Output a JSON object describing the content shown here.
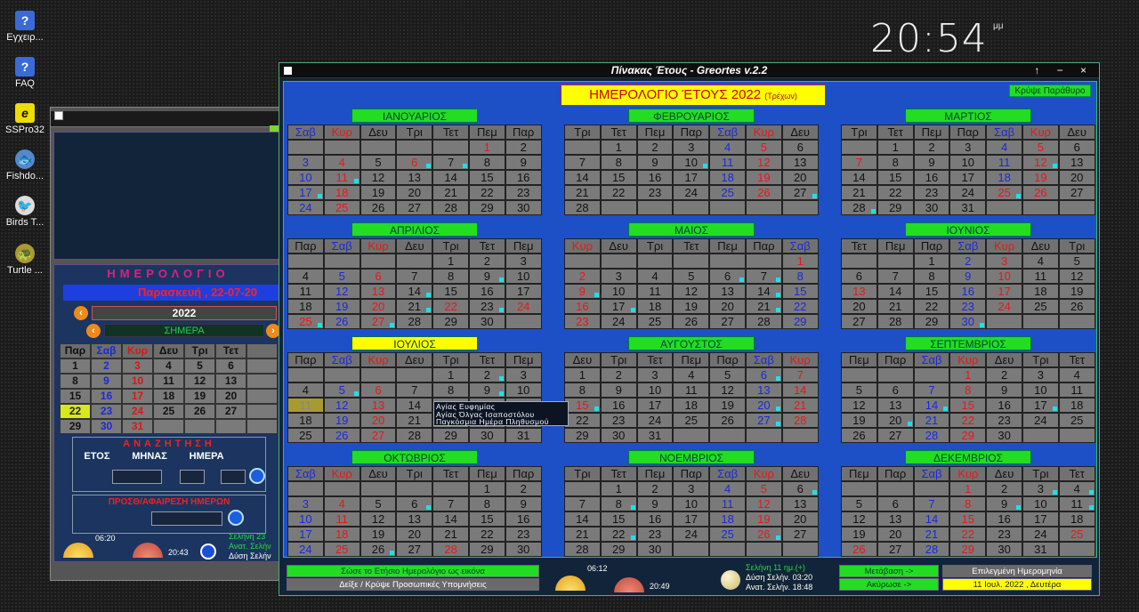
{
  "desktop": {
    "icons": [
      {
        "label": "Εγχειρ...",
        "glyph": "?"
      },
      {
        "label": "FAQ",
        "glyph": "?"
      },
      {
        "label": "SSPro32",
        "glyph": "e"
      },
      {
        "label": "Fishdo...",
        "glyph": "🐟"
      },
      {
        "label": "Birds T...",
        "glyph": "🐦"
      },
      {
        "label": "Turtle ...",
        "glyph": "🐢"
      }
    ],
    "clock": "20:54",
    "ampm": "μμ"
  },
  "small_window": {
    "title": "ΗΜΕΡΟΛΟΓΙΟ",
    "date_line": "Παρασκευή , 22-07-20",
    "year": "2022",
    "today_label": "ΣΗΜΕΡΑ",
    "headers": [
      "Παρ",
      "Σαβ",
      "Κυρ",
      "Δευ",
      "Τρι",
      "Τετ",
      ""
    ],
    "weeks": [
      [
        "1",
        "2",
        "3",
        "4",
        "5",
        "6",
        ""
      ],
      [
        "8",
        "9",
        "10",
        "11",
        "12",
        "13",
        ""
      ],
      [
        "15",
        "16",
        "17",
        "18",
        "19",
        "20",
        ""
      ],
      [
        "22",
        "23",
        "24",
        "25",
        "26",
        "27",
        ""
      ],
      [
        "29",
        "30",
        "31",
        "",
        "",
        "",
        ""
      ]
    ],
    "search_title": "ΑΝΑΖΗΤΗΣΗ",
    "search_headers": [
      "ΕΤΟΣ",
      "ΜΗΝΑΣ",
      "ΗΜΕΡΑ"
    ],
    "subtract_title": "ΠΡΟΣΘ/ΑΦΑΙΡΕΣΗ ΗΜΕΡΩΝ",
    "sunrise": "06:20",
    "sunset": "20:43",
    "moon_line1": "Σελήνη 23",
    "moon_line2": "Ανατ. Σελήν",
    "moon_line3": "Δύση Σελήν"
  },
  "main_window": {
    "title": "Πίνακας Έτους - Greortes v.2.2",
    "controls": "↑ − ×",
    "header_title": "ΗΜΕΡΟΛΟΓΙΟ ΈΤΟΥΣ 2022",
    "header_sub": "(Τρέχων)",
    "hide_button": "Κρύψε Παράθυρο",
    "tooltip": [
      "Αγίας Ευφημίας",
      "Αγίας Όλγας Ισαποστόλου",
      "Παγκόσμια Ημέρα Πληθυσμού"
    ],
    "bottom": {
      "save_button": "Σώσε το Ετήσιο Ημερολόγιο ως εικόνα",
      "notes_button": "Δείξε / Κρύψε Προσωπικές Υπομνήσεις",
      "sunrise": "06:12",
      "sunset": "20:49",
      "moon_phase": "Σελήνη 11 ημ.(+)",
      "moon_set": "Δύση Σελήν. 03:20",
      "moon_rise": "Ανατ. Σελήν. 18:48",
      "goto_button": "Μετάβαση ->",
      "cancel_button": "Ακύρωσε ->",
      "selected_label": "Επιλεγμένη Ημερομηνία",
      "selected_value": "11 Ιουλ. 2022 , Δευτέρα"
    }
  },
  "colors": {
    "green": "#22dd22",
    "yellow": "#ffff00",
    "panel_blue": "#1d4fc7",
    "saturday": "#1a2ad8",
    "sunday": "#e81818",
    "dot": "#1ee0e8"
  },
  "months": [
    {
      "name": "ΙΑΝΟΥΑΡΙΟΣ",
      "first": 5,
      "days": 31,
      "headers": [
        "Σαβ",
        "Κυρ",
        "Δευ",
        "Τρι",
        "Τετ",
        "Πεμ",
        "Παρ"
      ],
      "dots": [
        6,
        7,
        11,
        17
      ],
      "holidays": [
        1,
        6
      ]
    },
    {
      "name": "ΦΕΒΡΟΥΑΡΙΟΣ",
      "first": 1,
      "days": 28,
      "headers": [
        "Τρι",
        "Τετ",
        "Πεμ",
        "Παρ",
        "Σαβ",
        "Κυρ",
        "Δευ"
      ],
      "dots": [
        10,
        27
      ],
      "holidays": []
    },
    {
      "name": "ΜΑΡΤΙΟΣ",
      "first": 1,
      "days": 31,
      "headers": [
        "Τρι",
        "Τετ",
        "Πεμ",
        "Παρ",
        "Σαβ",
        "Κυρ",
        "Δευ"
      ],
      "dots": [
        12,
        25,
        28
      ],
      "holidays": [
        7,
        25
      ]
    },
    {
      "name": "ΑΠΡΙΛΙΟΣ",
      "first": 4,
      "days": 30,
      "headers": [
        "Παρ",
        "Σαβ",
        "Κυρ",
        "Δευ",
        "Τρι",
        "Τετ",
        "Πεμ"
      ],
      "dots": [
        9,
        14,
        21,
        23,
        25,
        27
      ],
      "holidays": [
        22,
        24,
        25
      ]
    },
    {
      "name": "ΜΑΙΟΣ",
      "first": 6,
      "days": 31,
      "headers": [
        "Κυρ",
        "Δευ",
        "Τρι",
        "Τετ",
        "Πεμ",
        "Παρ",
        "Σαβ"
      ],
      "dots": [
        6,
        7,
        9,
        14,
        17,
        21
      ],
      "holidays": [
        1
      ]
    },
    {
      "name": "ΙΟΥΝΙΟΣ",
      "first": 2,
      "days": 30,
      "headers": [
        "Τετ",
        "Πεμ",
        "Παρ",
        "Σαβ",
        "Κυρ",
        "Δευ",
        "Τρι"
      ],
      "dots": [
        30
      ],
      "holidays": [
        13
      ]
    },
    {
      "name": "ΙΟΥΛΙΟΣ",
      "first": 4,
      "days": 31,
      "headers": [
        "Παρ",
        "Σαβ",
        "Κυρ",
        "Δευ",
        "Τρι",
        "Τετ",
        "Πεμ"
      ],
      "dots": [
        2,
        5,
        9,
        15,
        16,
        24
      ],
      "holidays": [],
      "current": true,
      "today": 22,
      "selected": 11
    },
    {
      "name": "ΑΥΓΟΥΣΤΟΣ",
      "first": 0,
      "days": 31,
      "headers": [
        "Δευ",
        "Τρι",
        "Τετ",
        "Πεμ",
        "Παρ",
        "Σαβ",
        "Κυρ"
      ],
      "dots": [
        6,
        15,
        20,
        27
      ],
      "holidays": [
        15
      ]
    },
    {
      "name": "ΣΕΠΤΕΜΒΡΙΟΣ",
      "first": 3,
      "days": 30,
      "headers": [
        "Πεμ",
        "Παρ",
        "Σαβ",
        "Κυρ",
        "Δευ",
        "Τρι",
        "Τετ"
      ],
      "dots": [
        14,
        17,
        20
      ],
      "holidays": []
    },
    {
      "name": "ΟΚΤΩΒΡΙΟΣ",
      "first": 5,
      "days": 31,
      "headers": [
        "Σαβ",
        "Κυρ",
        "Δευ",
        "Τρι",
        "Τετ",
        "Πεμ",
        "Παρ"
      ],
      "dots": [
        6,
        26
      ],
      "holidays": [
        28
      ]
    },
    {
      "name": "ΝΟΕΜΒΡΙΟΣ",
      "first": 1,
      "days": 30,
      "headers": [
        "Τρι",
        "Τετ",
        "Πεμ",
        "Παρ",
        "Σαβ",
        "Κυρ",
        "Δευ"
      ],
      "dots": [
        6,
        8,
        22,
        26
      ],
      "holidays": []
    },
    {
      "name": "ΔΕΚΕΜΒΡΙΟΣ",
      "first": 3,
      "days": 31,
      "headers": [
        "Πεμ",
        "Παρ",
        "Σαβ",
        "Κυρ",
        "Δευ",
        "Τρι",
        "Τετ"
      ],
      "dots": [
        3,
        4,
        9,
        11
      ],
      "holidays": [
        25,
        26
      ]
    }
  ]
}
